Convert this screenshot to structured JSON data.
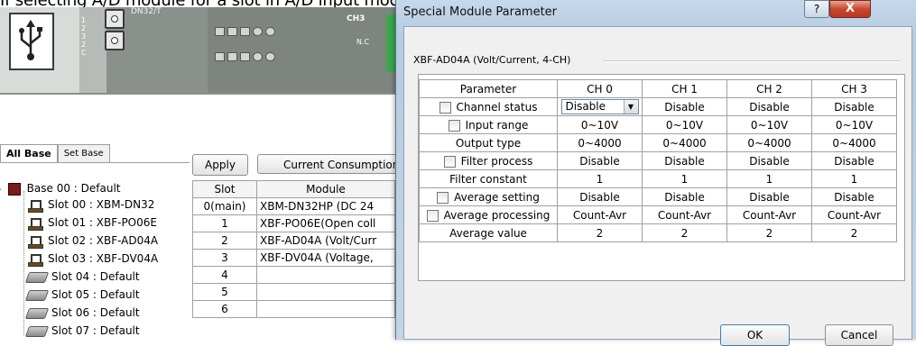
{
  "caption": "If selecting A/D module for a slot in A/D input module, it opens up the setting window as illustrated below.",
  "hardware": {
    "port_label": "1 2 3 2 C",
    "model_label": "DN32/T",
    "ch_label": "CH3",
    "nc_label": "N.C"
  },
  "left_panel": {
    "tabs": [
      "All Base",
      "Set Base"
    ],
    "tree": {
      "root": "Base 00 : Default",
      "slots": [
        {
          "label": "Slot 00 : XBM-DN32",
          "icon": "module-icon"
        },
        {
          "label": "Slot 01 : XBF-PO06E",
          "icon": "module-icon"
        },
        {
          "label": "Slot 02 : XBF-AD04A",
          "icon": "module-icon"
        },
        {
          "label": "Slot 03 : XBF-DV04A",
          "icon": "module-icon"
        },
        {
          "label": "Slot 04 : Default",
          "icon": "empty-slot-icon"
        },
        {
          "label": "Slot 05 : Default",
          "icon": "empty-slot-icon"
        },
        {
          "label": "Slot 06 : Default",
          "icon": "empty-slot-icon"
        },
        {
          "label": "Slot 07 : Default",
          "icon": "empty-slot-icon"
        }
      ]
    }
  },
  "toolbar": {
    "apply_label": "Apply",
    "consumption_label": "Current Consumption"
  },
  "slot_table": {
    "headers": [
      "Slot",
      "Module"
    ],
    "rows": [
      [
        "0(main)",
        "XBM-DN32HP (DC 24"
      ],
      [
        "1",
        "XBF-PO06E(Open coll"
      ],
      [
        "2",
        "XBF-AD04A (Volt/Curr"
      ],
      [
        "3",
        "XBF-DV04A (Voltage,"
      ],
      [
        "4",
        ""
      ],
      [
        "5",
        ""
      ],
      [
        "6",
        ""
      ]
    ]
  },
  "dialog": {
    "title": "Special Module Parameter",
    "help_label": "?",
    "close_label": "X",
    "group_label": "XBF-AD04A (Volt/Current, 4-CH)",
    "columns": [
      "Parameter",
      "CH 0",
      "CH 1",
      "CH 2",
      "CH 3"
    ],
    "rows": [
      {
        "label": "Channel status",
        "checkbox": true,
        "values": [
          "Disable",
          "Disable",
          "Disable",
          "Disable"
        ]
      },
      {
        "label": "Input range",
        "checkbox": true,
        "values": [
          "0~10V",
          "0~10V",
          "0~10V",
          "0~10V"
        ]
      },
      {
        "label": "Output type",
        "checkbox": false,
        "values": [
          "0~4000",
          "0~4000",
          "0~4000",
          "0~4000"
        ]
      },
      {
        "label": "Filter process",
        "checkbox": true,
        "values": [
          "Disable",
          "Disable",
          "Disable",
          "Disable"
        ]
      },
      {
        "label": "Filter constant",
        "checkbox": false,
        "values": [
          "1",
          "1",
          "1",
          "1"
        ]
      },
      {
        "label": "Average setting",
        "checkbox": true,
        "values": [
          "Disable",
          "Disable",
          "Disable",
          "Disable"
        ]
      },
      {
        "label": "Average processing",
        "checkbox": true,
        "values": [
          "Count-Avr",
          "Count-Avr",
          "Count-Avr",
          "Count-Avr"
        ]
      },
      {
        "label": "Average value",
        "checkbox": false,
        "values": [
          "2",
          "2",
          "2",
          "2"
        ]
      }
    ],
    "ok_label": "OK",
    "cancel_label": "Cancel"
  }
}
